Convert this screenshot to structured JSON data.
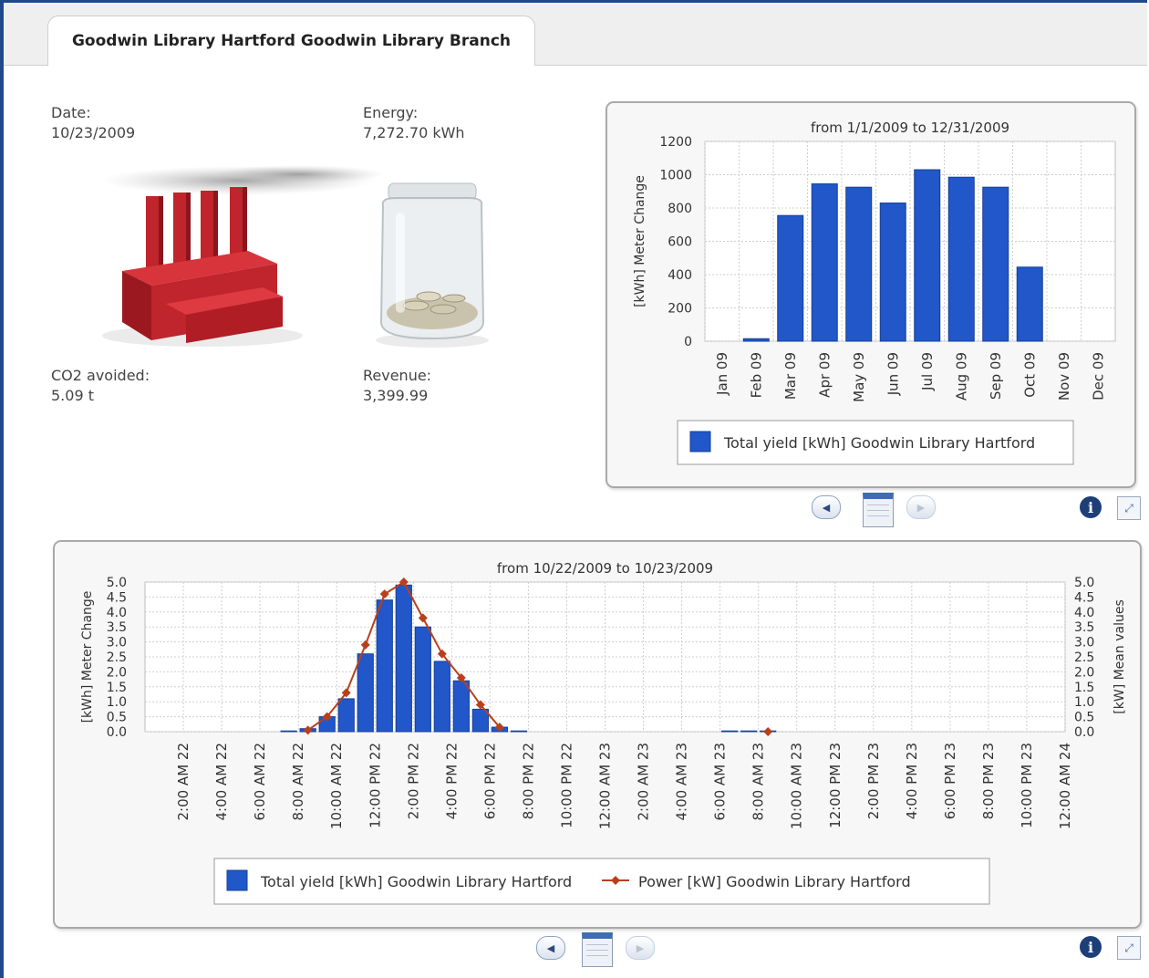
{
  "tab": {
    "title": "Goodwin Library Hartford Goodwin Library Branch"
  },
  "summary": {
    "date_label": "Date:",
    "date_value": "10/23/2009",
    "energy_label": "Energy:",
    "energy_value": "7,272.70 kWh",
    "co2_label": "CO2 avoided:",
    "co2_value": "5.09 t",
    "revenue_label": "Revenue:",
    "revenue_value": "3,399.99"
  },
  "colors": {
    "bar": "#2157c9",
    "bar_edge": "#163f96",
    "line": "#b8401c",
    "grid": "#cfcfcf",
    "frame": "#1e4a8c"
  },
  "icons": {
    "factory": "factory-icon",
    "jar": "coin-jar-icon",
    "prev": "chevron-left-icon",
    "next": "chevron-right-icon",
    "calendar": "calendar-icon",
    "info": "info-icon",
    "fullscreen": "fullscreen-icon"
  },
  "chart_data": [
    {
      "type": "bar",
      "title": "from 1/1/2009 to 12/31/2009",
      "ylabel": "[kWh] Meter Change",
      "xlabel": "",
      "ylim": [
        0,
        1200
      ],
      "yticks": [
        0,
        200,
        400,
        600,
        800,
        1000,
        1200
      ],
      "categories": [
        "Jan 09",
        "Feb 09",
        "Mar 09",
        "Apr 09",
        "May 09",
        "Jun 09",
        "Jul 09",
        "Aug 09",
        "Sep 09",
        "Oct 09",
        "Nov 09",
        "Dec 09"
      ],
      "series": [
        {
          "name": "Total yield [kWh] Goodwin Library Hartford",
          "values": [
            0,
            15,
            755,
            945,
            925,
            830,
            1030,
            985,
            925,
            445,
            0,
            0
          ]
        }
      ],
      "grid": true,
      "legend": "bottom"
    },
    {
      "type": "bar",
      "title": "from 10/22/2009 to 10/23/2009",
      "ylabel": "[kWh] Meter Change",
      "y2label": "[kW] Mean values",
      "ylim": [
        0,
        5
      ],
      "y2lim": [
        0,
        5
      ],
      "yticks": [
        "0.0",
        "0.5",
        "1.0",
        "1.5",
        "2.0",
        "2.5",
        "3.0",
        "3.5",
        "4.0",
        "4.5",
        "5.0"
      ],
      "x_tick_labels": [
        "2:00 AM 22",
        "4:00 AM 22",
        "6:00 AM 22",
        "8:00 AM 22",
        "10:00 AM 22",
        "12:00 PM 22",
        "2:00 PM 22",
        "4:00 PM 22",
        "6:00 PM 22",
        "8:00 PM 22",
        "10:00 PM 22",
        "12:00 AM 23",
        "2:00 AM 23",
        "4:00 AM 23",
        "6:00 AM 23",
        "8:00 AM 23",
        "10:00 AM 23",
        "12:00 PM 23",
        "2:00 PM 23",
        "4:00 PM 23",
        "6:00 PM 23",
        "8:00 PM 23",
        "10:00 PM 23",
        "12:00 AM 24"
      ],
      "x": [
        "7:00 AM 22",
        "8:00 AM 22",
        "9:00 AM 22",
        "10:00 AM 22",
        "11:00 AM 22",
        "12:00 PM 22",
        "1:00 PM 22",
        "2:00 PM 22",
        "3:00 PM 22",
        "4:00 PM 22",
        "5:00 PM 22",
        "6:00 PM 22",
        "7:00 PM 22",
        "6:00 AM 23",
        "7:00 AM 23",
        "8:00 AM 23"
      ],
      "x_hours": [
        7,
        8,
        9,
        10,
        11,
        12,
        13,
        14,
        15,
        16,
        17,
        18,
        19,
        30,
        31,
        32
      ],
      "series": [
        {
          "name": "Total yield [kWh] Goodwin Library Hartford",
          "type": "bar",
          "values": [
            0.02,
            0.1,
            0.5,
            1.1,
            2.6,
            4.4,
            4.9,
            3.5,
            2.35,
            1.7,
            0.75,
            0.15,
            0.02,
            0.0,
            0.02,
            0.0
          ]
        },
        {
          "name": "Power [kW] Goodwin Library Hartford",
          "type": "line",
          "values": [
            null,
            0.05,
            0.5,
            1.3,
            2.9,
            4.6,
            5.0,
            3.8,
            2.6,
            1.8,
            0.9,
            0.15,
            null,
            null,
            null,
            0.0
          ]
        }
      ],
      "grid": true,
      "legend": "bottom"
    }
  ]
}
